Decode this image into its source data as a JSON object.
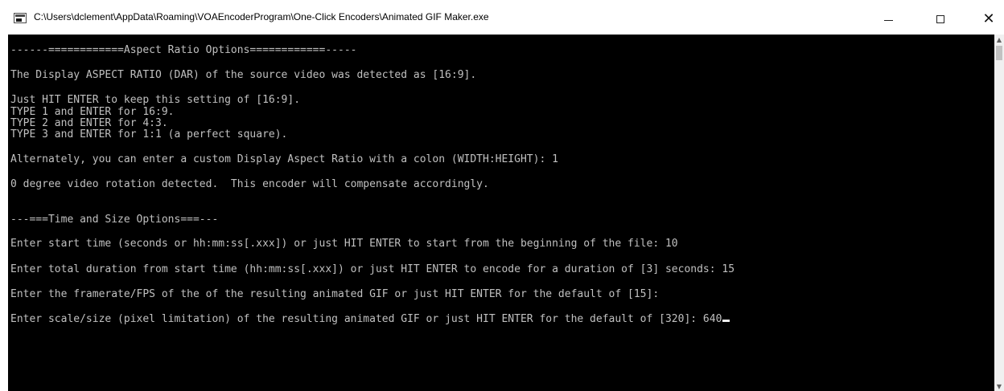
{
  "window": {
    "title": "C:\\Users\\dclement\\AppData\\Roaming\\VOAEncoderProgram\\One-Click Encoders\\Animated GIF Maker.exe",
    "icon": "console-app-icon",
    "controls": {
      "minimize": "minimize-icon",
      "maximize": "maximize-icon",
      "close": "close-icon"
    }
  },
  "console": {
    "lines": [
      "------============Aspect Ratio Options============-----",
      "The Display ASPECT RATIO (DAR) of the source video was detected as [16:9].",
      "Just HIT ENTER to keep this setting of [16:9].",
      "TYPE 1 and ENTER for 16:9.",
      "TYPE 2 and ENTER for 4:3.",
      "TYPE 3 and ENTER for 1:1 (a perfect square).",
      "Alternately, you can enter a custom Display Aspect Ratio with a colon (WIDTH:HEIGHT): 1",
      "0 degree video rotation detected.  This encoder will compensate accordingly.",
      "---===Time and Size Options===---",
      "Enter start time (seconds or hh:mm:ss[.xxx]) or just HIT ENTER to start from the beginning of the file: 10",
      "Enter total duration from start time (hh:mm:ss[.xxx]) or just HIT ENTER to encode for a duration of [3] seconds: 15",
      "Enter the framerate/FPS of the of the resulting animated GIF or just HIT ENTER for the default of [15]:",
      "Enter scale/size (pixel limitation) of the resulting animated GIF or just HIT ENTER for the default of [320]: 640"
    ]
  },
  "colors": {
    "console_bg": "#000000",
    "console_text": "#c0c0c0",
    "titlebar_bg": "#ffffff"
  }
}
